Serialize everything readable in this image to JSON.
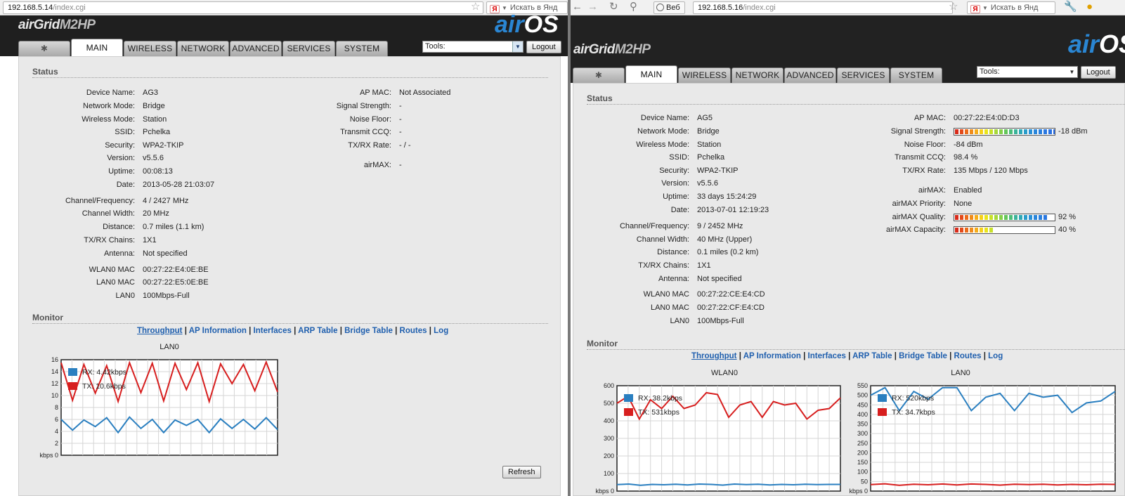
{
  "left": {
    "url_host": "192.168.5.14",
    "url_path": "/index.cgi",
    "search_placeholder": "Искать в Янд",
    "product_logo": "airGrid",
    "product_model": "M2HP",
    "brand_logo": "air",
    "brand_logo_os": "OS",
    "tabs": [
      {
        "label": "MAIN"
      },
      {
        "label": "WIRELESS"
      },
      {
        "label": "NETWORK"
      },
      {
        "label": "ADVANCED"
      },
      {
        "label": "SERVICES"
      },
      {
        "label": "SYSTEM"
      }
    ],
    "tools_value": "Tools:",
    "logout_label": "Logout",
    "status_title": "Status",
    "status_left": [
      {
        "label": "Device Name:",
        "value": "AG3"
      },
      {
        "label": "Network Mode:",
        "value": "Bridge"
      },
      {
        "label": "Wireless Mode:",
        "value": "Station"
      },
      {
        "label": "SSID:",
        "value": "Pchelka"
      },
      {
        "label": "Security:",
        "value": "WPA2-TKIP"
      },
      {
        "label": "Version:",
        "value": "v5.5.6"
      },
      {
        "label": "Uptime:",
        "value": "00:08:13"
      },
      {
        "label": "Date:",
        "value": "2013-05-28 21:03:07"
      },
      {
        "label": "Channel/Frequency:",
        "value": "4 / 2427 MHz"
      },
      {
        "label": "Channel Width:",
        "value": "20 MHz"
      },
      {
        "label": "Distance:",
        "value": "0.7 miles (1.1 km)"
      },
      {
        "label": "TX/RX Chains:",
        "value": "1X1"
      },
      {
        "label": "Antenna:",
        "value": "Not specified"
      },
      {
        "label": "WLAN0 MAC",
        "value": "00:27:22:E4:0E:BE"
      },
      {
        "label": "LAN0 MAC",
        "value": "00:27:22:E5:0E:BE"
      },
      {
        "label": "LAN0",
        "value": "100Mbps-Full"
      }
    ],
    "status_right": [
      {
        "label": "AP MAC:",
        "value": "Not Associated"
      },
      {
        "label": "Signal Strength:",
        "value": "-"
      },
      {
        "label": "Noise Floor:",
        "value": "-"
      },
      {
        "label": "Transmit CCQ:",
        "value": "-"
      },
      {
        "label": "TX/RX Rate:",
        "value": "- / -"
      },
      {
        "label": "airMAX:",
        "value": "-"
      }
    ],
    "monitor_title": "Monitor",
    "monitor_links": [
      "Throughput",
      "AP Information",
      "Interfaces",
      "ARP Table",
      "Bridge Table",
      "Routes",
      "Log"
    ],
    "refresh_label": "Refresh"
  },
  "right": {
    "url_host": "192.168.5.16",
    "url_path": "/index.cgi",
    "web_label": "Веб",
    "search_placeholder": "Искать в Янд",
    "product_logo": "airGrid",
    "product_model": "M2HP",
    "brand_logo": "air",
    "brand_logo_os": "OS",
    "tabs": [
      {
        "label": "MAIN"
      },
      {
        "label": "WIRELESS"
      },
      {
        "label": "NETWORK"
      },
      {
        "label": "ADVANCED"
      },
      {
        "label": "SERVICES"
      },
      {
        "label": "SYSTEM"
      }
    ],
    "tools_value": "Tools:",
    "logout_label": "Logout",
    "status_title": "Status",
    "status_left": [
      {
        "label": "Device Name:",
        "value": "AG5"
      },
      {
        "label": "Network Mode:",
        "value": "Bridge"
      },
      {
        "label": "Wireless Mode:",
        "value": "Station"
      },
      {
        "label": "SSID:",
        "value": "Pchelka"
      },
      {
        "label": "Security:",
        "value": "WPA2-TKIP"
      },
      {
        "label": "Version:",
        "value": "v5.5.6"
      },
      {
        "label": "Uptime:",
        "value": "33 days 15:24:29"
      },
      {
        "label": "Date:",
        "value": "2013-07-01 12:19:23"
      },
      {
        "label": "Channel/Frequency:",
        "value": "9 / 2452 MHz"
      },
      {
        "label": "Channel Width:",
        "value": "40 MHz (Upper)"
      },
      {
        "label": "Distance:",
        "value": "0.1 miles (0.2 km)"
      },
      {
        "label": "TX/RX Chains:",
        "value": "1X1"
      },
      {
        "label": "Antenna:",
        "value": "Not specified"
      },
      {
        "label": "WLAN0 MAC",
        "value": "00:27:22:CE:E4:CD"
      },
      {
        "label": "LAN0 MAC",
        "value": "00:27:22:CF:E4:CD"
      },
      {
        "label": "LAN0",
        "value": "100Mbps-Full"
      }
    ],
    "status_right": [
      {
        "label": "AP MAC:",
        "value": "00:27:22:E4:0D:D3"
      },
      {
        "label": "Signal Strength:",
        "value": "-18 dBm",
        "meter": 1.0
      },
      {
        "label": "Noise Floor:",
        "value": "-84 dBm"
      },
      {
        "label": "Transmit CCQ:",
        "value": "98.4 %"
      },
      {
        "label": "TX/RX Rate:",
        "value": "135 Mbps / 120 Mbps"
      },
      {
        "label": "airMAX:",
        "value": "Enabled"
      },
      {
        "label": "airMAX Priority:",
        "value": "None"
      },
      {
        "label": "airMAX Quality:",
        "value": "92 %",
        "meter": 0.92
      },
      {
        "label": "airMAX Capacity:",
        "value": "40 %",
        "meter": 0.4
      }
    ],
    "monitor_title": "Monitor",
    "monitor_links": [
      "Throughput",
      "AP Information",
      "Interfaces",
      "ARP Table",
      "Bridge Table",
      "Routes",
      "Log"
    ]
  },
  "chart_data": [
    {
      "type": "line",
      "title": "LAN0",
      "ylabel": "kbps",
      "ylim": [
        0,
        16
      ],
      "yticks": [
        0,
        2,
        4,
        6,
        8,
        10,
        12,
        14,
        16
      ],
      "series": [
        {
          "name": "RX: 4.42kbps",
          "color": "#2a7fc0",
          "values": [
            6.0,
            4.2,
            5.9,
            4.8,
            6.3,
            3.8,
            6.4,
            4.5,
            6.0,
            3.8,
            5.9,
            5.0,
            6.0,
            3.8,
            6.1,
            4.5,
            6.0,
            4.4,
            6.3,
            4.3
          ]
        },
        {
          "name": "TX: 10.6kbps",
          "color": "#d71e1e",
          "values": [
            15.5,
            9.2,
            15.2,
            10.4,
            15.0,
            9.0,
            15.5,
            10.5,
            15.4,
            9.1,
            15.4,
            11.0,
            15.5,
            9.0,
            15.3,
            12.0,
            15.2,
            10.8,
            15.6,
            10.6
          ]
        }
      ]
    },
    {
      "type": "line",
      "title": "WLAN0",
      "ylabel": "kbps",
      "ylim": [
        0,
        600
      ],
      "yticks": [
        0,
        100,
        200,
        300,
        400,
        500,
        600
      ],
      "series": [
        {
          "name": "RX: 38.2kbps",
          "color": "#2a7fc0",
          "values": [
            37,
            40,
            33,
            38,
            36,
            39,
            35,
            40,
            38,
            34,
            40,
            37,
            39,
            35,
            38,
            36,
            39,
            37,
            38,
            38
          ]
        },
        {
          "name": "TX: 531kbps",
          "color": "#d71e1e",
          "values": [
            500,
            540,
            410,
            520,
            470,
            540,
            470,
            490,
            560,
            550,
            420,
            490,
            510,
            420,
            510,
            490,
            500,
            410,
            460,
            470,
            531
          ]
        }
      ]
    },
    {
      "type": "line",
      "title": "LAN0",
      "ylabel": "kbps",
      "ylim": [
        0,
        550
      ],
      "yticks": [
        0,
        50,
        100,
        150,
        200,
        250,
        300,
        350,
        400,
        450,
        500,
        550
      ],
      "series": [
        {
          "name": "RX: 520kbps",
          "color": "#2a7fc0",
          "values": [
            500,
            540,
            420,
            520,
            480,
            540,
            540,
            420,
            490,
            510,
            420,
            510,
            490,
            500,
            410,
            460,
            470,
            520
          ]
        },
        {
          "name": "TX: 34.7kbps",
          "color": "#d71e1e",
          "values": [
            34,
            38,
            30,
            36,
            33,
            37,
            32,
            37,
            35,
            31,
            36,
            34,
            36,
            32,
            35,
            33,
            36,
            35
          ]
        }
      ]
    }
  ]
}
